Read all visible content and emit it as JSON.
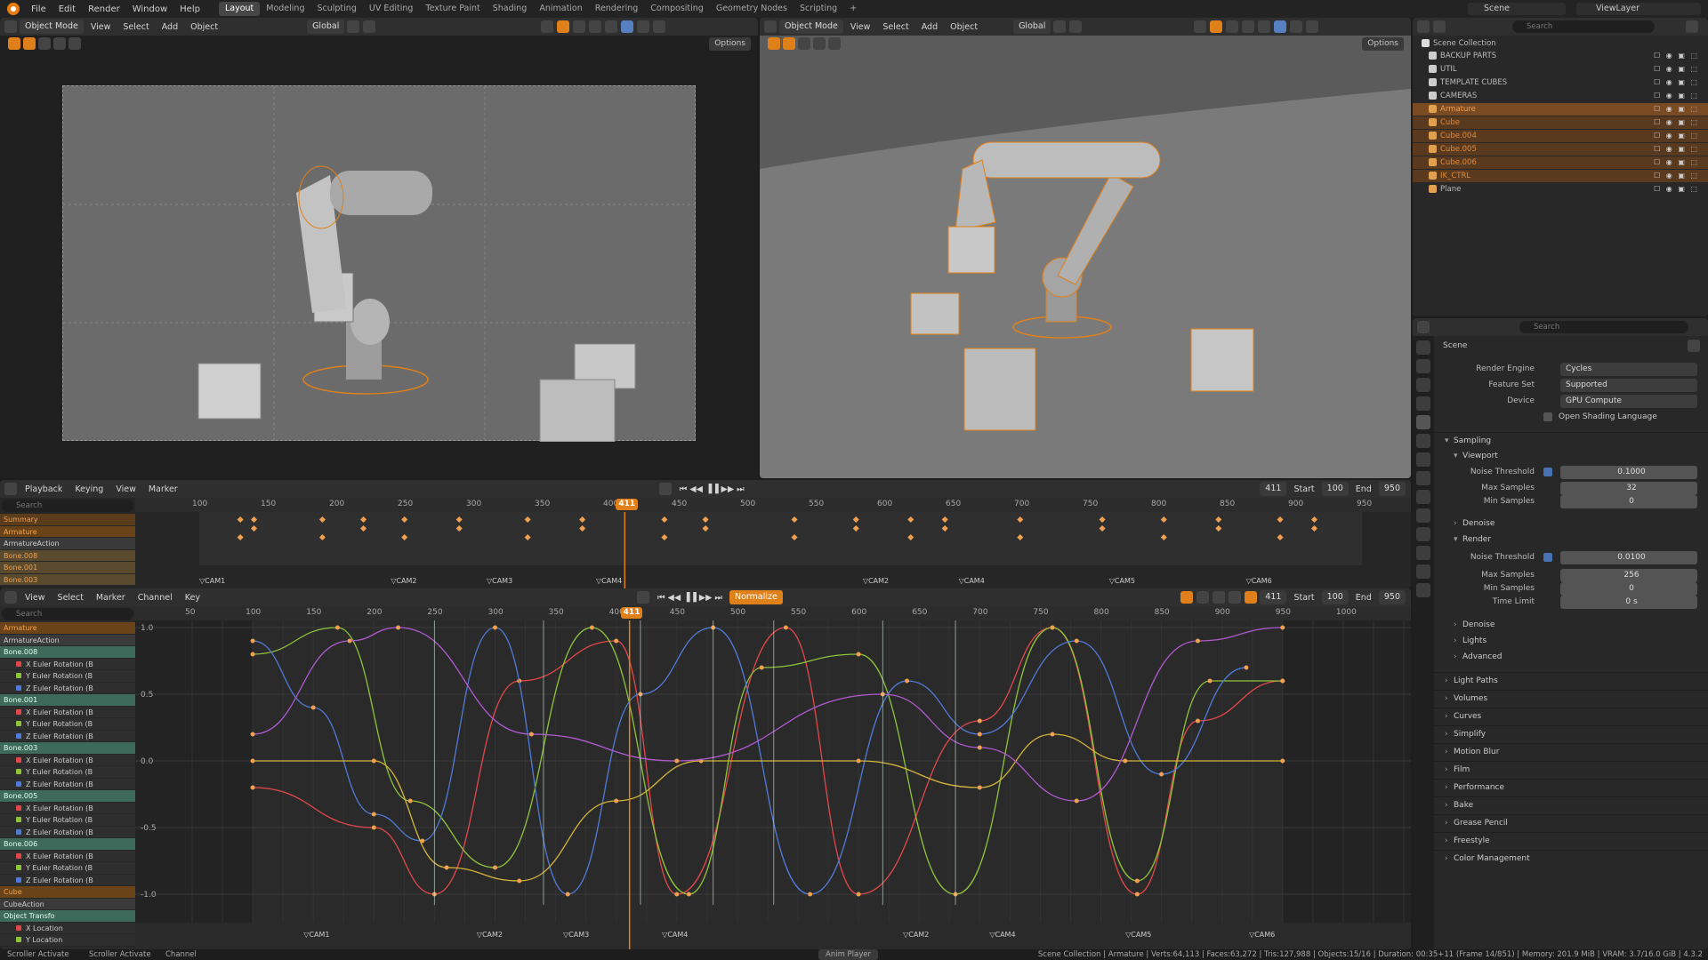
{
  "topbar": {
    "menus": [
      "File",
      "Edit",
      "Render",
      "Window",
      "Help"
    ],
    "workspaces": [
      "Layout",
      "Modeling",
      "Sculpting",
      "UV Editing",
      "Texture Paint",
      "Shading",
      "Animation",
      "Rendering",
      "Compositing",
      "Geometry Nodes",
      "Scripting"
    ],
    "active_workspace": "Layout",
    "scene": "Scene",
    "view_layer": "ViewLayer"
  },
  "viewport": {
    "mode": "Object Mode",
    "menus": [
      "View",
      "Select",
      "Add",
      "Object"
    ],
    "orientation": "Global",
    "options": "Options"
  },
  "outliner": {
    "search_placeholder": "Search",
    "root": "Scene Collection",
    "items": [
      {
        "name": "BACKUP PARTS",
        "type": "collection",
        "state": "normal"
      },
      {
        "name": "UTIL",
        "type": "collection",
        "state": "normal"
      },
      {
        "name": "TEMPLATE CUBES",
        "type": "collection",
        "state": "normal"
      },
      {
        "name": "CAMERAS",
        "type": "collection",
        "state": "normal"
      },
      {
        "name": "Armature",
        "type": "armature",
        "state": "active"
      },
      {
        "name": "Cube",
        "type": "mesh",
        "state": "selected"
      },
      {
        "name": "Cube.004",
        "type": "mesh",
        "state": "selected"
      },
      {
        "name": "Cube.005",
        "type": "mesh",
        "state": "selected"
      },
      {
        "name": "Cube.006",
        "type": "mesh",
        "state": "selected"
      },
      {
        "name": "IK_CTRL",
        "type": "empty",
        "state": "selected"
      },
      {
        "name": "Plane",
        "type": "mesh",
        "state": "normal"
      }
    ]
  },
  "properties": {
    "search_placeholder": "Search",
    "context": "Scene",
    "render_engine_label": "Render Engine",
    "render_engine": "Cycles",
    "feature_set_label": "Feature Set",
    "feature_set": "Supported",
    "device_label": "Device",
    "device": "GPU Compute",
    "osl_label": "Open Shading Language",
    "sampling": "Sampling",
    "viewport": "Viewport",
    "noise_threshold_label": "Noise Threshold",
    "vp_noise_threshold": "0.1000",
    "max_samples_label": "Max Samples",
    "vp_max_samples": "32",
    "min_samples_label": "Min Samples",
    "vp_min_samples": "0",
    "denoise_label": "Denoise",
    "render": "Render",
    "r_noise_threshold": "0.0100",
    "r_max_samples": "256",
    "r_min_samples": "0",
    "time_limit_label": "Time Limit",
    "r_time_limit": "0 s",
    "lights": "Lights",
    "advanced": "Advanced",
    "sections": [
      "Light Paths",
      "Volumes",
      "Curves",
      "Simplify",
      "Motion Blur",
      "Film",
      "Performance",
      "Bake",
      "Grease Pencil",
      "Freestyle",
      "Color Management"
    ]
  },
  "dopesheet": {
    "menus": [
      "Playback",
      "Keying",
      "View",
      "Marker"
    ],
    "current_frame": "411",
    "start_label": "Start",
    "start": "100",
    "end_label": "End",
    "end": "950",
    "search_placeholder": "Search",
    "ruler": [
      "100",
      "150",
      "200",
      "250",
      "300",
      "350",
      "400",
      "450",
      "500",
      "550",
      "600",
      "650",
      "700",
      "750",
      "800",
      "850",
      "900",
      "950"
    ],
    "channels": [
      {
        "label": "Summary",
        "kind": "sum"
      },
      {
        "label": "Armature",
        "kind": "obj"
      },
      {
        "label": "ArmatureAction",
        "kind": "act"
      },
      {
        "label": "Bone.008",
        "kind": "bone2"
      },
      {
        "label": "Bone.001",
        "kind": "bone2"
      },
      {
        "label": "Bone.003",
        "kind": "bone2"
      }
    ],
    "markers": [
      {
        "name": "CAM1",
        "frame": 100
      },
      {
        "name": "CAM2",
        "frame": 240
      },
      {
        "name": "CAM3",
        "frame": 310
      },
      {
        "name": "CAM4",
        "frame": 390
      },
      {
        "name": "CAM2",
        "frame": 585
      },
      {
        "name": "CAM4",
        "frame": 655
      },
      {
        "name": "CAM5",
        "frame": 765
      },
      {
        "name": "CAM6",
        "frame": 865
      }
    ]
  },
  "graph": {
    "menus": [
      "View",
      "Select",
      "Marker",
      "Channel",
      "Key"
    ],
    "normalize": "Normalize",
    "current_frame": "411",
    "start": "100",
    "end": "950",
    "ruler": [
      "50",
      "100",
      "150",
      "200",
      "250",
      "300",
      "350",
      "400",
      "450",
      "500",
      "550",
      "600",
      "650",
      "700",
      "750",
      "800",
      "850",
      "900",
      "950",
      "1000"
    ],
    "y_labels": [
      "1.0",
      "0.5",
      "0.0",
      "-0.5",
      "-1.0"
    ],
    "channels": [
      {
        "label": "Armature",
        "kind": "obj"
      },
      {
        "label": "ArmatureAction",
        "kind": "act"
      },
      {
        "label": "Bone.008",
        "kind": "bone"
      },
      {
        "label": "X Euler Rotation (B",
        "kind": "x"
      },
      {
        "label": "Y Euler Rotation (B",
        "kind": "y"
      },
      {
        "label": "Z Euler Rotation (B",
        "kind": "z"
      },
      {
        "label": "Bone.001",
        "kind": "bone"
      },
      {
        "label": "X Euler Rotation (B",
        "kind": "x"
      },
      {
        "label": "Y Euler Rotation (B",
        "kind": "y"
      },
      {
        "label": "Z Euler Rotation (B",
        "kind": "z"
      },
      {
        "label": "Bone.003",
        "kind": "bone"
      },
      {
        "label": "X Euler Rotation (B",
        "kind": "x"
      },
      {
        "label": "Y Euler Rotation (B",
        "kind": "y"
      },
      {
        "label": "Z Euler Rotation (B",
        "kind": "z"
      },
      {
        "label": "Bone.005",
        "kind": "bone"
      },
      {
        "label": "X Euler Rotation (B",
        "kind": "x"
      },
      {
        "label": "Y Euler Rotation (B",
        "kind": "y"
      },
      {
        "label": "Z Euler Rotation (B",
        "kind": "z"
      },
      {
        "label": "Bone.006",
        "kind": "bone"
      },
      {
        "label": "X Euler Rotation (B",
        "kind": "x"
      },
      {
        "label": "Y Euler Rotation (B",
        "kind": "y"
      },
      {
        "label": "Z Euler Rotation (B",
        "kind": "z"
      },
      {
        "label": "Cube",
        "kind": "obj"
      },
      {
        "label": "CubeAction",
        "kind": "act"
      },
      {
        "label": "Object Transfo",
        "kind": "bone"
      },
      {
        "label": "X Location",
        "kind": "x"
      },
      {
        "label": "Y Location",
        "kind": "y"
      }
    ]
  },
  "status": {
    "left1": "Scroller Activate",
    "left2": "Scroller Activate",
    "left3": "Channel",
    "center": "Anim Player",
    "right": "Scene Collection | Armature | Verts:64,113 | Faces:63,272 | Tris:127,988 | Objects:15/16 | Duration: 00:35+11 (Frame 14/851) | Memory: 201.9 MiB | VRAM: 3.7/16.0 GiB | 4.3.2"
  },
  "colors": {
    "accent": "#e0801a",
    "x_curve": "#e2484b",
    "y_curve": "#8fc43a",
    "z_curve": "#4f7bd8",
    "selected": "#f0a050"
  }
}
